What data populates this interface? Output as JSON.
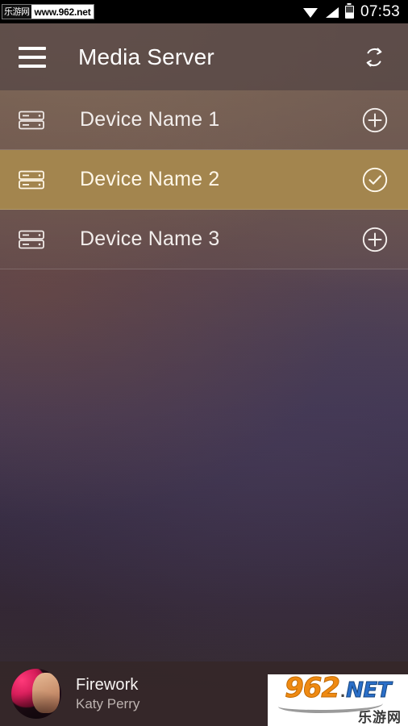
{
  "status_bar": {
    "watermark_cn": "乐游网",
    "watermark_url": "www.962.net",
    "time": "07:53",
    "icons": [
      "wifi-icon",
      "cellular-signal-icon",
      "battery-icon"
    ]
  },
  "app_bar": {
    "menu_icon": "hamburger-menu-icon",
    "title": "Media Server",
    "refresh_icon": "refresh-sync-icon"
  },
  "device_list": {
    "rows": [
      {
        "label": "Device Name 1",
        "icon": "server-device-icon",
        "action_icon": "plus-circle-icon",
        "selected": false
      },
      {
        "label": "Device Name 2",
        "icon": "server-device-icon",
        "action_icon": "check-circle-icon",
        "selected": true
      },
      {
        "label": "Device Name 3",
        "icon": "server-device-icon",
        "action_icon": "plus-circle-icon",
        "selected": false
      }
    ]
  },
  "player": {
    "album_art": "album-art-firework",
    "title": "Firework",
    "artist": "Katy Perry",
    "controls": [
      {
        "name": "previous-button",
        "icon": "skip-previous-icon"
      },
      {
        "name": "play-pause-button",
        "icon": "pause-icon"
      },
      {
        "name": "next-button",
        "icon": "skip-next-icon"
      }
    ]
  },
  "watermark_overlay": {
    "brand": "962",
    "separator": ".",
    "tld": "NET",
    "subtitle": "乐游网"
  },
  "colors": {
    "selected_row": "#a3854e",
    "app_bar": "#564646",
    "player_bar": "#352729",
    "text_primary": "#f2eeec",
    "text_secondary": "#bdb3b0"
  }
}
